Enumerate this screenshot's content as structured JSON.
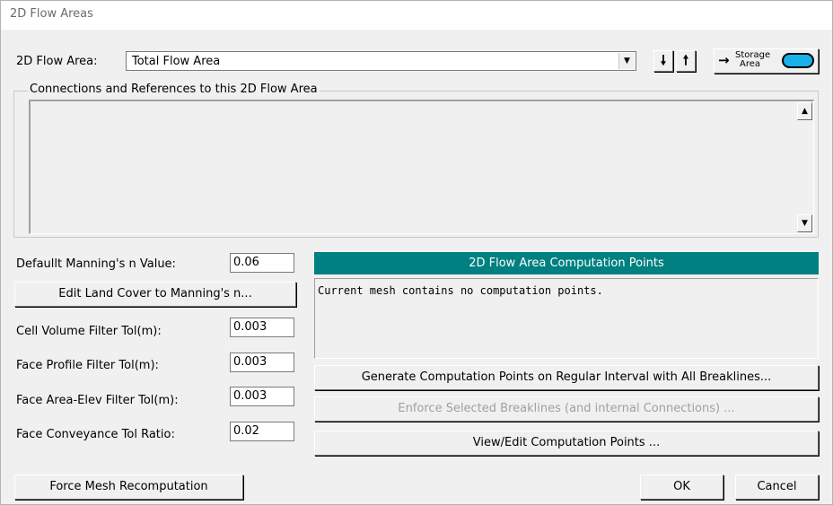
{
  "window": {
    "title": "2D Flow Areas"
  },
  "top": {
    "area_label": "2D Flow Area:",
    "area_value": "Total Flow Area",
    "storage_btn_top": "Storage",
    "storage_btn_bottom": "Area"
  },
  "connections": {
    "group_label": "Connections and References to this 2D Flow Area"
  },
  "params": {
    "mannings_label": "Defaullt Manning's n Value:",
    "mannings_value": "0.06",
    "edit_landcover_button": "Edit Land Cover to Manning's n...",
    "cell_volume_label": "Cell Volume Filter Tol(m):",
    "cell_volume_value": "0.003",
    "face_profile_label": "Face Profile Filter Tol(m):",
    "face_profile_value": "0.003",
    "face_area_label": "Face Area-Elev Filter Tol(m):",
    "face_area_value": "0.003",
    "face_conveyance_label": "Face Conveyance Tol Ratio:",
    "face_conveyance_value": "0.02"
  },
  "computation": {
    "header": "2D Flow Area Computation Points",
    "message": "Current mesh contains no computation points.",
    "generate_button": "Generate Computation Points on Regular Interval with All Breaklines...",
    "enforce_button": "Enforce Selected Breaklines (and internal Connections) ...",
    "view_edit_button": "View/Edit Computation Points ..."
  },
  "footer": {
    "force_mesh_button": "Force Mesh Recomputation",
    "ok_button": "OK",
    "cancel_button": "Cancel"
  },
  "colors": {
    "header_bar": "#008080",
    "storage_shape": "#1ab0e8"
  }
}
